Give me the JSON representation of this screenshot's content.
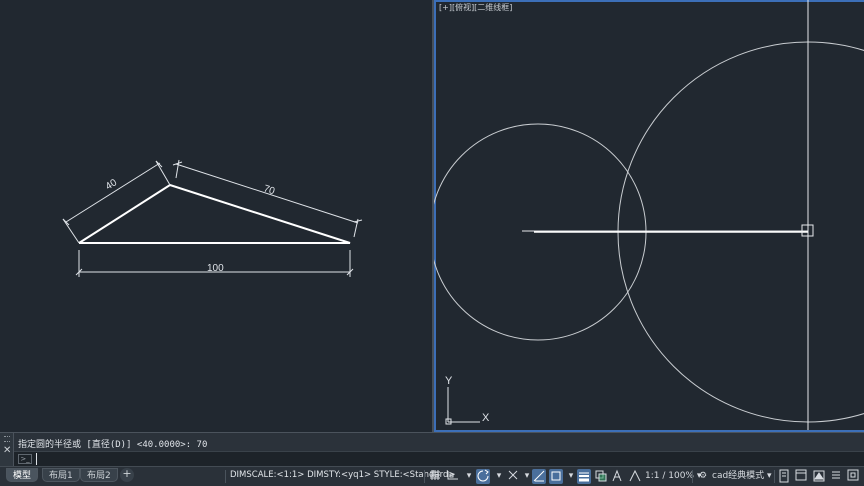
{
  "viewport_right": {
    "label": "[+][俯视][二维线框]",
    "ucs_x": "X",
    "ucs_y": "Y"
  },
  "drawing_left": {
    "dim_a": "40",
    "dim_b": "70",
    "dim_c": "100"
  },
  "command": {
    "history": "指定圆的半径或 [直径(D)] <40.0000>: 70",
    "prompt_icon": ">_",
    "input_value": "",
    "close_glyph": "✕"
  },
  "layout_tabs": [
    "模型",
    "布局1",
    "布局2"
  ],
  "tab_add": "+",
  "status": {
    "text": "DIMSCALE:<1:1> DIMSTY:<yq1> STYLE:<Standard>",
    "scale": "1:1 / 100%",
    "workspace": "cad经典模式"
  },
  "icons": {
    "grid": "grid-icon",
    "snap": "snap-icon",
    "ortho": "ortho-icon",
    "polar": "polar-icon",
    "osnap": "osnap-icon",
    "otrack": "otrack-icon",
    "lineweight": "lineweight-icon",
    "annotation": "annotation-icon",
    "gear": "gear-icon",
    "fullscreen": "fullscreen-icon"
  },
  "colors": {
    "background": "#212830",
    "active_border": "#3c6fb8",
    "geometry": "#ffffff",
    "toggle_on": "#4a6f9c"
  }
}
